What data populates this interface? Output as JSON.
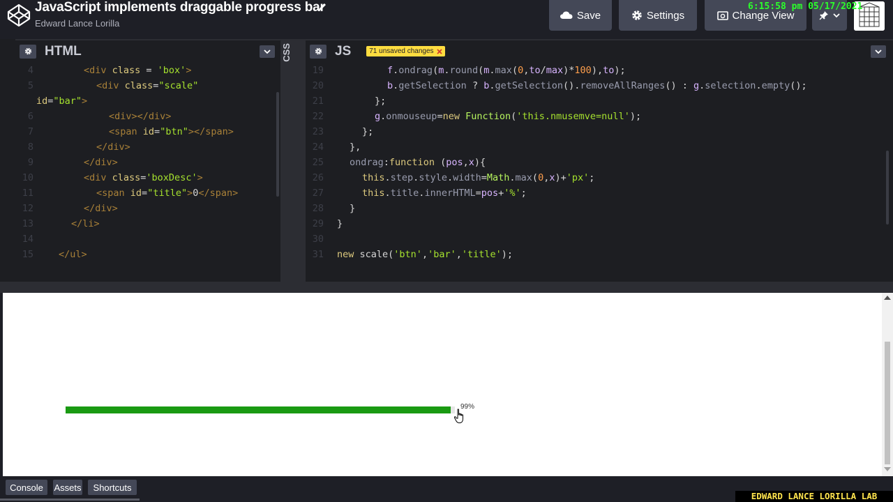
{
  "header": {
    "title": "JavaScript implements draggable progress bar",
    "author": "Edward Lance Lorilla",
    "save_label": "Save",
    "settings_label": "Settings",
    "change_view_label": "Change View",
    "clock": "6:15:58 pm 05/17/2021"
  },
  "html_pane": {
    "title": "HTML",
    "lines": [
      {
        "n": "4",
        "indent": 2,
        "html": "<span class='t-tag'>&lt;div </span><span class='t-attr'>class</span><span class='t-plain'> = </span><span class='t-str'>'box'</span><span class='t-tag'>&gt;</span>"
      },
      {
        "n": "5",
        "indent": 3,
        "html": "<span class='t-tag'>&lt;div </span><span class='t-attr'>class</span><span class='t-plain'>=</span><span class='t-str'>\"scale\"</span>"
      },
      {
        "n": "",
        "indent": 0,
        "html": "<span class='t-attr'>id</span><span class='t-plain'>=</span><span class='t-str'>\"bar\"</span><span class='t-tag'>&gt;</span>"
      },
      {
        "n": "6",
        "indent": 4,
        "html": "<span class='t-tag'>&lt;div&gt;&lt;/div&gt;</span>"
      },
      {
        "n": "7",
        "indent": 4,
        "html": "<span class='t-tag'>&lt;span </span><span class='t-attr'>id</span><span class='t-plain'>=</span><span class='t-str'>\"btn\"</span><span class='t-tag'>&gt;&lt;/span&gt;</span>"
      },
      {
        "n": "8",
        "indent": 3,
        "html": "<span class='t-tag'>&lt;/div&gt;</span>"
      },
      {
        "n": "9",
        "indent": 2,
        "html": "<span class='t-tag'>&lt;/div&gt;</span>"
      },
      {
        "n": "10",
        "indent": 2,
        "html": "<span class='t-tag'>&lt;div </span><span class='t-attr'>class</span><span class='t-plain'>=</span><span class='t-str'>'boxDesc'</span><span class='t-tag'>&gt;</span>"
      },
      {
        "n": "11",
        "indent": 3,
        "html": "<span class='t-tag'>&lt;span </span><span class='t-attr'>id</span><span class='t-plain'>=</span><span class='t-str'>\"title\"</span><span class='t-tag'>&gt;</span><span class='t-plain'>0</span><span class='t-tag'>&lt;/span&gt;</span>"
      },
      {
        "n": "12",
        "indent": 2,
        "html": "<span class='t-tag'>&lt;/div&gt;</span>"
      },
      {
        "n": "13",
        "indent": 1,
        "html": "<span class='t-tag'>&lt;/li&gt;</span>"
      },
      {
        "n": "14",
        "indent": 0,
        "html": ""
      },
      {
        "n": "15",
        "indent": 0,
        "html": "<span class='t-tag'>&lt;/ul&gt;</span>"
      }
    ]
  },
  "css_pane": {
    "title": "CSS"
  },
  "js_pane": {
    "title": "JS",
    "unsaved_label": "71 unsaved changes",
    "lines": [
      {
        "n": "19",
        "indent": 4,
        "html": "<span class='t-var'>f</span><span class='t-plain'>.</span><span class='t-prop'>ondrag</span><span class='t-plain'>(</span><span class='t-var'>m</span><span class='t-plain'>.</span><span class='t-prop'>round</span><span class='t-plain'>(</span><span class='t-var'>m</span><span class='t-plain'>.</span><span class='t-prop'>max</span><span class='t-plain'>(</span><span class='t-num'>0</span><span class='t-plain'>,</span><span class='t-var'>to</span><span class='t-plain'>/</span><span class='t-var'>max</span><span class='t-plain'>)*</span><span class='t-num'>100</span><span class='t-plain'>),</span><span class='t-var'>to</span><span class='t-plain'>);</span>"
      },
      {
        "n": "20",
        "indent": 4,
        "html": "<span class='t-var'>b</span><span class='t-plain'>.</span><span class='t-prop'>getSelection</span><span class='t-plain'> ? </span><span class='t-var'>b</span><span class='t-plain'>.</span><span class='t-prop'>getSelection</span><span class='t-plain'>().</span><span class='t-prop'>removeAllRanges</span><span class='t-plain'>() : </span><span class='t-var'>g</span><span class='t-plain'>.</span><span class='t-prop'>selection</span><span class='t-plain'>.</span><span class='t-prop'>empty</span><span class='t-plain'>();</span>"
      },
      {
        "n": "21",
        "indent": 3,
        "html": "<span class='t-plain'>};</span>"
      },
      {
        "n": "22",
        "indent": 3,
        "html": "<span class='t-var'>g</span><span class='t-plain'>.</span><span class='t-prop'>onmouseup</span><span class='t-plain'>=</span><span class='t-kw'>new </span><span class='t-fn'>Function</span><span class='t-plain'>(</span><span class='t-str'>'this.nmusemve=null'</span><span class='t-plain'>);</span>"
      },
      {
        "n": "23",
        "indent": 2,
        "html": "<span class='t-plain'>};</span>"
      },
      {
        "n": "24",
        "indent": 1,
        "html": "<span class='t-plain'>},</span>"
      },
      {
        "n": "25",
        "indent": 1,
        "html": "<span class='t-prop'>ondrag</span><span class='t-plain'>:</span><span class='t-kw'>function</span><span class='t-plain'> (</span><span class='t-var'>pos</span><span class='t-plain'>,</span><span class='t-var'>x</span><span class='t-plain'>){</span>"
      },
      {
        "n": "26",
        "indent": 2,
        "html": "<span class='t-kw'>this</span><span class='t-plain'>.</span><span class='t-prop'>step</span><span class='t-plain'>.</span><span class='t-prop'>style</span><span class='t-plain'>.</span><span class='t-prop'>width</span><span class='t-plain'>=</span><span class='t-fn'>Math</span><span class='t-plain'>.</span><span class='t-prop'>max</span><span class='t-plain'>(</span><span class='t-num'>0</span><span class='t-plain'>,</span><span class='t-var'>x</span><span class='t-plain'>)+</span><span class='t-str'>'px'</span><span class='t-plain'>;</span>"
      },
      {
        "n": "27",
        "indent": 2,
        "html": "<span class='t-kw'>this</span><span class='t-plain'>.</span><span class='t-prop'>title</span><span class='t-plain'>.</span><span class='t-prop'>innerHTML</span><span class='t-plain'>=</span><span class='t-var'>pos</span><span class='t-plain'>+</span><span class='t-str'>'%'</span><span class='t-plain'>;</span>"
      },
      {
        "n": "28",
        "indent": 1,
        "html": "<span class='t-plain'>}</span>"
      },
      {
        "n": "29",
        "indent": 0,
        "html": "<span class='t-plain'>}</span>"
      },
      {
        "n": "30",
        "indent": 0,
        "html": ""
      },
      {
        "n": "31",
        "indent": 0,
        "html": "<span class='t-kw'>new </span><span class='t-plain'>scale(</span><span class='t-str'>'btn'</span><span class='t-plain'>,</span><span class='t-str'>'bar'</span><span class='t-plain'>,</span><span class='t-str'>'title'</span><span class='t-plain'>);</span>"
      }
    ]
  },
  "preview": {
    "progress_percent": 99,
    "progress_label": "99%",
    "progress_color": "#1a9a12"
  },
  "footer": {
    "console_label": "Console",
    "assets_label": "Assets",
    "shortcuts_label": "Shortcuts",
    "watermark": "EDWARD LANCE LORILLA LAB"
  },
  "icons": [
    "codepen-logo-icon",
    "pencil-icon",
    "cloud-icon",
    "gear-icon",
    "change-view-icon",
    "pin-icon",
    "chevron-down-icon",
    "close-icon",
    "hand-cursor-icon"
  ],
  "colors": {
    "accent_yellow": "#ffdd40",
    "header_bg": "#1e1f26",
    "button_bg": "#444857",
    "clock_green": "#2bff2b"
  }
}
